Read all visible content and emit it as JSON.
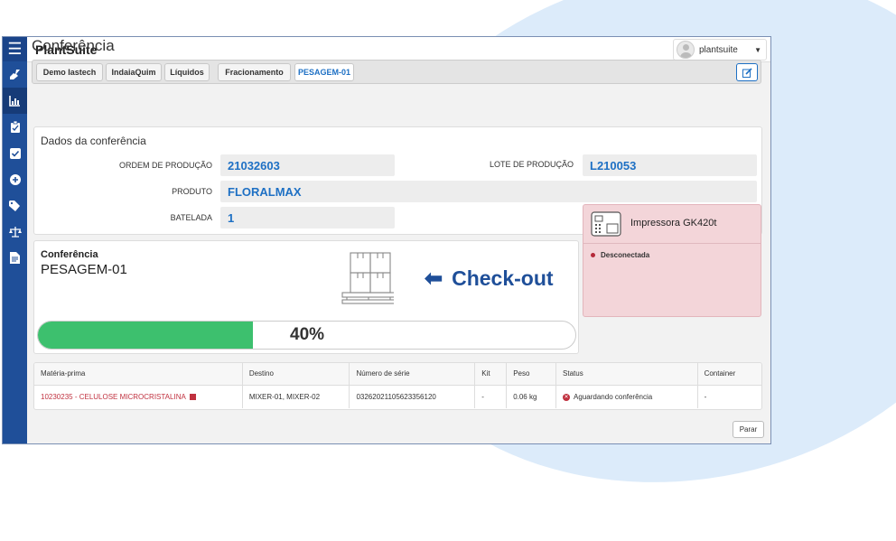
{
  "app": {
    "brand": "PlantSuite",
    "user": "plantsuite"
  },
  "page": {
    "title": "Conferência"
  },
  "breadcrumb": [
    "Demo Iastech",
    "IndaiaQuim",
    "Líquidos",
    "Fracionamento",
    "PESAGEM-01"
  ],
  "dados": {
    "title": "Dados da conferência",
    "ordem_label": "ORDEM DE PRODUÇÃO",
    "ordem_value": "21032603",
    "lote_label": "LOTE DE PRODUÇÃO",
    "lote_value": "L210053",
    "produto_label": "PRODUTO",
    "produto_value": "FLORALMAX",
    "batelada_label": "BATELADA",
    "batelada_value": "1"
  },
  "conferencia": {
    "label": "Conferência",
    "value": "PESAGEM-01",
    "action": "Check-out",
    "progress_text": "40%",
    "progress_value": 40
  },
  "printer": {
    "name": "Impressora GK420t",
    "status": "Desconectada"
  },
  "table": {
    "headers": [
      "Matéria-prima",
      "Destino",
      "Número de série",
      "Kit",
      "Peso",
      "Status",
      "Container"
    ],
    "row": {
      "materia": "10230235 - CELULOSE MICROCRISTALINA",
      "destino": "MIXER-01, MIXER-02",
      "serie": "03262021105623356120",
      "kit": "-",
      "peso": "0.06 kg",
      "status": "Aguardando conferência",
      "container": "-"
    }
  },
  "buttons": {
    "parar": "Parar"
  },
  "colors": {
    "sidebar": "#1f4f99",
    "accent": "#1e70c4",
    "progress": "#3dc06e",
    "danger": "#c0313f"
  },
  "icons": {
    "sidebar": [
      "menu-icon",
      "broom-icon",
      "chart-icon",
      "clipboard-icon",
      "checkbox-icon",
      "plus-circle-icon",
      "tag-icon",
      "scale-icon",
      "document-icon"
    ],
    "printer": "printer-icon",
    "boxes": "boxes-icon"
  }
}
